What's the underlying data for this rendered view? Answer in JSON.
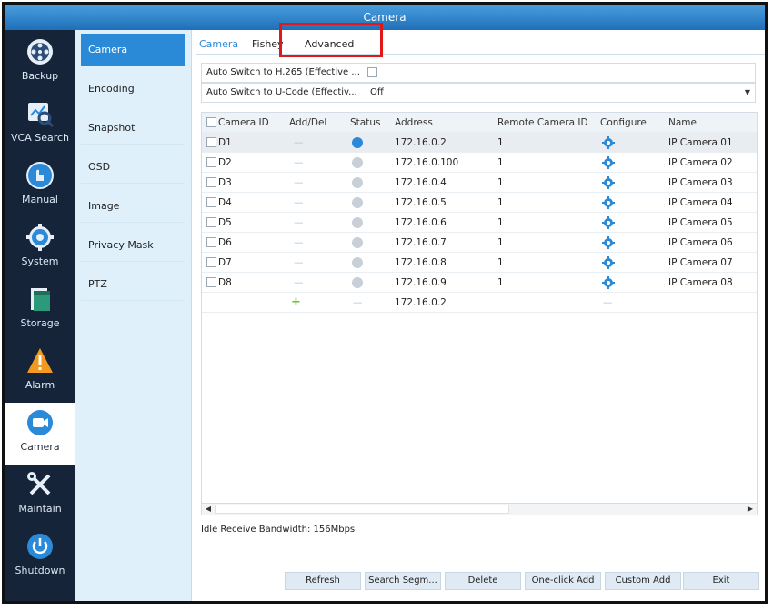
{
  "window": {
    "title": "Camera"
  },
  "left_nav": [
    {
      "label": "Backup",
      "icon": "backup-icon"
    },
    {
      "label": "VCA Search",
      "icon": "vca-search-icon"
    },
    {
      "label": "Manual",
      "icon": "manual-icon"
    },
    {
      "label": "System",
      "icon": "system-gear-icon"
    },
    {
      "label": "Storage",
      "icon": "storage-icon"
    },
    {
      "label": "Alarm",
      "icon": "alarm-icon"
    },
    {
      "label": "Camera",
      "icon": "camera-icon",
      "active": true
    },
    {
      "label": "Maintain",
      "icon": "maintain-tools-icon"
    },
    {
      "label": "Shutdown",
      "icon": "shutdown-icon"
    }
  ],
  "sub_nav": [
    {
      "label": "Camera",
      "active": true
    },
    {
      "label": "Encoding"
    },
    {
      "label": "Snapshot"
    },
    {
      "label": "OSD"
    },
    {
      "label": "Image"
    },
    {
      "label": "Privacy Mask"
    },
    {
      "label": "PTZ"
    }
  ],
  "tabs": [
    {
      "label": "Camera",
      "active": true
    },
    {
      "label": "Fisheye"
    },
    {
      "label": "Advanced"
    }
  ],
  "options": {
    "h265_label": "Auto Switch to H.265 (Effective ...",
    "ucode_label": "Auto Switch to U-Code (Effectiv...",
    "ucode_value": "Off"
  },
  "table": {
    "columns": [
      "Camera ID",
      "Add/Del",
      "Status",
      "Address",
      "Remote Camera ID",
      "Configure",
      "Name"
    ],
    "rows": [
      {
        "id": "D1",
        "add_del": "—",
        "status": "online",
        "address": "172.16.0.2",
        "remote_id": "1",
        "name": "IP Camera 01"
      },
      {
        "id": "D2",
        "add_del": "—",
        "status": "offline",
        "address": "172.16.0.100",
        "remote_id": "1",
        "name": "IP Camera 02"
      },
      {
        "id": "D3",
        "add_del": "—",
        "status": "offline",
        "address": "172.16.0.4",
        "remote_id": "1",
        "name": "IP Camera 03"
      },
      {
        "id": "D4",
        "add_del": "—",
        "status": "offline",
        "address": "172.16.0.5",
        "remote_id": "1",
        "name": "IP Camera 04"
      },
      {
        "id": "D5",
        "add_del": "—",
        "status": "offline",
        "address": "172.16.0.6",
        "remote_id": "1",
        "name": "IP Camera 05"
      },
      {
        "id": "D6",
        "add_del": "—",
        "status": "offline",
        "address": "172.16.0.7",
        "remote_id": "1",
        "name": "IP Camera 06"
      },
      {
        "id": "D7",
        "add_del": "—",
        "status": "offline",
        "address": "172.16.0.8",
        "remote_id": "1",
        "name": "IP Camera 07"
      },
      {
        "id": "D8",
        "add_del": "—",
        "status": "offline",
        "address": "172.16.0.9",
        "remote_id": "1",
        "name": "IP Camera 08"
      }
    ],
    "add_row": {
      "add_del": "+",
      "status": "—",
      "address": "172.16.0.2",
      "configure": "—"
    }
  },
  "bandwidth_text": "Idle Receive Bandwidth: 156Mbps",
  "buttons": [
    "Refresh",
    "Search Segm...",
    "Delete",
    "One-click Add",
    "Custom Add",
    "Exit"
  ],
  "colors": {
    "accent": "#2b8ad8",
    "nav_bg": "#16243a",
    "highlight": "#e01818",
    "status_online": "#2b8ad8",
    "status_offline": "#c9cfd6",
    "plus": "#6cbf3e"
  }
}
